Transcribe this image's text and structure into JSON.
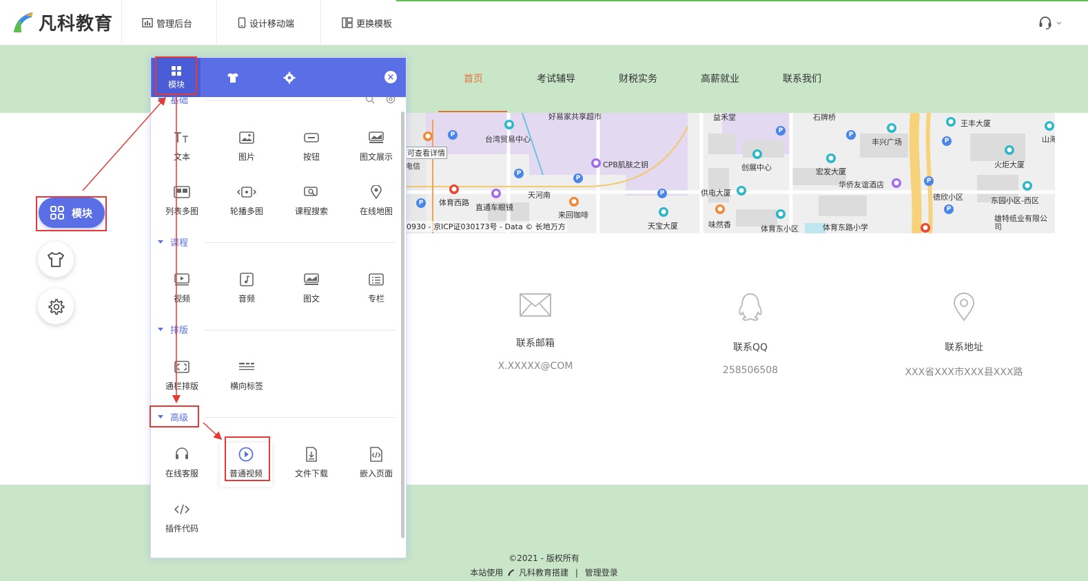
{
  "toolbar": {
    "logo_text": "凡科教育",
    "items": [
      {
        "label": "管理后台",
        "icon": "bar-chart-icon"
      },
      {
        "label": "设计移动端",
        "icon": "mobile-icon"
      },
      {
        "label": "更换模板",
        "icon": "template-icon"
      }
    ],
    "support_icon": "headset-icon"
  },
  "site_nav": {
    "items": [
      "首页",
      "考试辅导",
      "财税实务",
      "高薪就业",
      "联系我们"
    ],
    "active_index": 0
  },
  "map": {
    "labels": [
      "好易家共享超市",
      "益禾堂",
      "石牌桥",
      "王丰大厦",
      "台湾贸易中心",
      "丰兴广场",
      "可查看详情",
      "电信",
      "CPB肌肤之钥",
      "创展中心",
      "宏发大厦",
      "火炬大厦",
      "华侨友谊酒店",
      "天河南",
      "供电大厦",
      "德欣小区",
      "体育西路",
      "直通车眼镜",
      "东园小区-西区",
      "来回咖啡",
      "雄特纸业有限公司",
      "天宝大厦",
      "味然香",
      "体育东小区",
      "体育东路小学",
      "山海"
    ],
    "copyright": "0930 - 京ICP证030173号 - Data © 长地万方"
  },
  "contact": [
    {
      "title": "联系邮箱",
      "value": "X.XXXXX@COM",
      "icon": "mail-icon"
    },
    {
      "title": "联系QQ",
      "value": "258506508",
      "icon": "qq-icon"
    },
    {
      "title": "联系地址",
      "value": "XXX省XXX市XXX县XXX路",
      "icon": "location-icon"
    }
  ],
  "footer": {
    "copyright": "©2021 - 版权所有",
    "built_with": "本站使用",
    "builder": "凡科教育搭建",
    "divider": "|",
    "admin_login": "管理登录"
  },
  "left_fab": {
    "module_label": "模块"
  },
  "panel": {
    "tabs": [
      {
        "label": "模块",
        "icon": "grid-icon",
        "active": true
      },
      {
        "label": "",
        "icon": "shirt-icon",
        "active": false
      },
      {
        "label": "",
        "icon": "gear-icon",
        "active": false
      }
    ],
    "close_glyph": "×",
    "sections": [
      {
        "title": "基础",
        "items": [
          "文本",
          "图片",
          "按钮",
          "图文展示",
          "列表多图",
          "轮播多图",
          "课程搜索",
          "在线地图"
        ]
      },
      {
        "title": "课程",
        "items": [
          "视频",
          "音频",
          "图文",
          "专栏"
        ]
      },
      {
        "title": "排版",
        "items": [
          "通栏排版",
          "横向标签"
        ]
      },
      {
        "title": "高级",
        "items": [
          "在线客服",
          "普通视频",
          "文件下载",
          "嵌入页面",
          "插件代码"
        ]
      }
    ]
  },
  "colors": {
    "accent": "#5a6ee6",
    "header_bg": "#c9e6c9",
    "nav_active": "#e8703a",
    "annotation": "#e53935"
  }
}
